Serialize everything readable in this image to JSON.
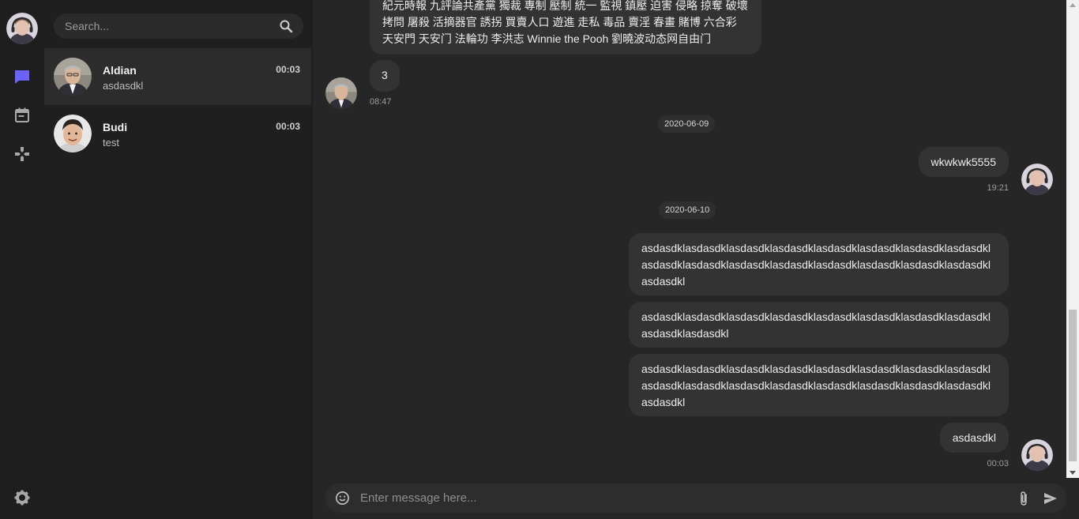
{
  "search": {
    "placeholder": "Search..."
  },
  "contacts": [
    {
      "name": "Aldian",
      "preview": "asdasdkl",
      "time": "00:03",
      "active": true
    },
    {
      "name": "Budi",
      "preview": "test",
      "time": "00:03",
      "active": false
    }
  ],
  "messages": {
    "incoming_long": "紀元時報 九評論共產黨 獨裁 專制 壓制 統一 監視 鎮壓 迫害 侵略 掠奪 破壞 拷問 屠殺 活摘器官 誘拐 買賣人口 遊進 走私 毒品 賣淫 春畫 賭博 六合彩 天安門 天安门 法輪功 李洪志 Winnie the Pooh 劉曉波动态网自由门",
    "incoming_short": "3",
    "incoming_time": "08:47",
    "date1": "2020-06-09",
    "out1": "wkwkwk5555",
    "out1_time": "19:21",
    "date2": "2020-06-10",
    "out2": "asdasdklasdasdklasdasdklasdasdklasdasdklasdasdklasdasdklasdasdklasdasdklasdasdklasdasdklasdasdklasdasdklasdasdklasdasdklasdasdklasdasdkl",
    "out3": "asdasdklasdasdklasdasdklasdasdklasdasdklasdasdklasdasdklasdasdklasdasdklasdasdkl",
    "out4": "asdasdklasdasdklasdasdklasdasdklasdasdklasdasdklasdasdklasdasdklasdasdklasdasdklasdasdklasdasdklasdasdklasdasdklasdasdklasdasdklasdasdkl",
    "out5": "asdasdkl",
    "out5_time": "00:03"
  },
  "composer": {
    "placeholder": "Enter message here..."
  },
  "colors": {
    "accent": "#6c63ff",
    "rail_bg": "#1e1e1e",
    "list_bg": "#1f1f1f",
    "chat_bg": "#262626",
    "bubble_bg": "#333333"
  },
  "icons": [
    "chat-icon",
    "calendar-icon",
    "gamepad-icon",
    "gear-icon",
    "search-icon",
    "emoji-icon",
    "paperclip-icon",
    "send-icon"
  ]
}
